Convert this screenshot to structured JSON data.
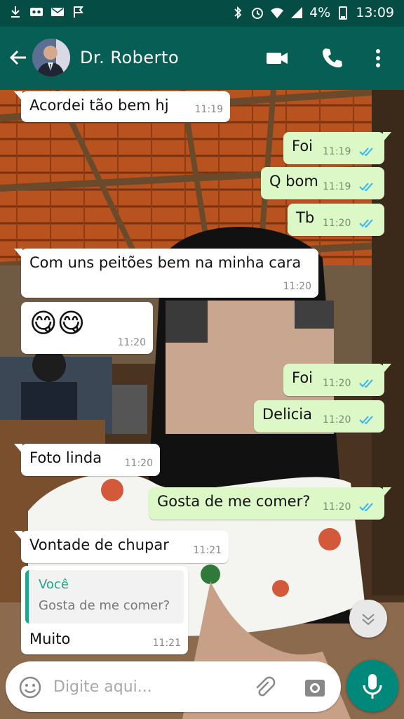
{
  "status_bar": {
    "battery": "4%",
    "time": "13:09"
  },
  "header": {
    "contact_name": "Dr. Roberto"
  },
  "messages": [
    {
      "direction": "in",
      "text": "Acordei tão bem hj",
      "time": "11:19"
    },
    {
      "direction": "out",
      "text": "Foi",
      "time": "11:19",
      "status": "read"
    },
    {
      "direction": "out",
      "text": "Q bom",
      "time": "11:19",
      "status": "read"
    },
    {
      "direction": "out",
      "text": "Tb",
      "time": "11:20",
      "status": "read"
    },
    {
      "direction": "in",
      "text": "Com uns peitões bem na minha cara",
      "time": "11:20"
    },
    {
      "direction": "in",
      "text": "😋😋",
      "time": "11:20"
    },
    {
      "direction": "out",
      "text": "Foi",
      "time": "11:20",
      "status": "read"
    },
    {
      "direction": "out",
      "text": "Delicia",
      "time": "11:20",
      "status": "read"
    },
    {
      "direction": "in",
      "text": "Foto linda",
      "time": "11:20"
    },
    {
      "direction": "out",
      "text": "Gosta de me comer?",
      "time": "11:20",
      "status": "read"
    },
    {
      "direction": "in",
      "text": "Vontade de chupar",
      "time": "11:21"
    },
    {
      "direction": "in",
      "text": "Muito",
      "time": "11:21",
      "quote": {
        "author": "Você",
        "text": "Gosta de me comer?"
      }
    }
  ],
  "composer": {
    "placeholder": "Digite aqui..."
  },
  "colors": {
    "header": "#075e54",
    "status_bar": "#054d44",
    "outgoing_bubble": "#dcf8c6",
    "incoming_bubble": "#ffffff",
    "read_ticks": "#34b7f1",
    "mic_button": "#00897b"
  },
  "icons": {
    "status_left": [
      "download-icon",
      "voicemail-icon",
      "mail-icon",
      "check-flag-icon"
    ],
    "status_right": [
      "bluetooth-mute-icon",
      "alarm-icon",
      "wifi-icon",
      "signal-icon",
      "battery-icon"
    ],
    "header": [
      "back-arrow-icon",
      "video-call-icon",
      "phone-icon",
      "more-vert-icon"
    ],
    "composer": [
      "emoji-icon",
      "attach-icon",
      "camera-icon",
      "mic-icon"
    ]
  }
}
